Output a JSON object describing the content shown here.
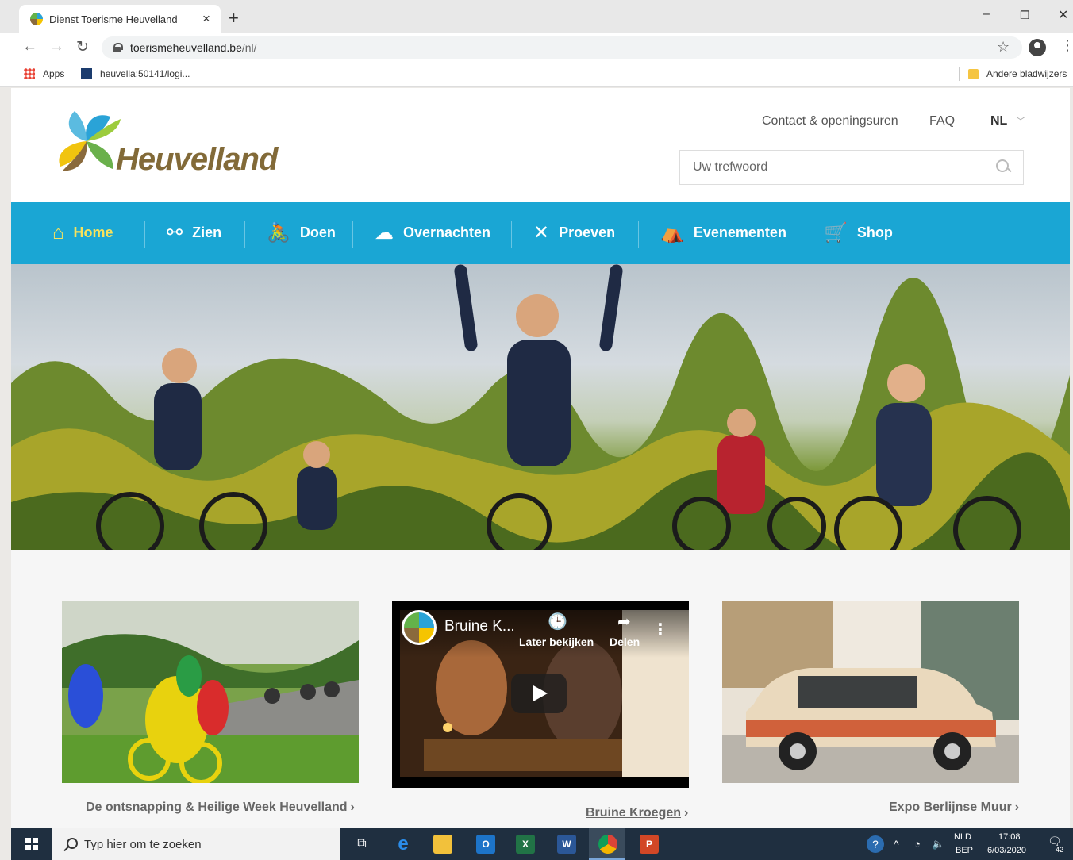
{
  "browser": {
    "tab_title": "Dienst Toerisme Heuvelland",
    "tab_close": "×",
    "new_tab": "+",
    "url_host": "toerismeheuvelland.be",
    "url_path": "/nl/",
    "bookmarks": [
      {
        "label": "Apps",
        "icon": "apps-grid-icon"
      },
      {
        "label": "heuvella:50141/logi..."
      }
    ],
    "other_bookmarks": "Andere bladwijzers",
    "window_controls": {
      "minimize": "–",
      "restore": "❐",
      "close": "✕"
    }
  },
  "site": {
    "logo_text": "Heuvelland",
    "top_links": [
      "Contact & openingsuren",
      "FAQ"
    ],
    "language": "NL",
    "search_placeholder": "Uw trefwoord",
    "nav": [
      {
        "label": "Home",
        "icon": "home-icon",
        "glyph": "⌂",
        "active": true
      },
      {
        "label": "Zien",
        "icon": "binoculars-icon",
        "glyph": "⚯"
      },
      {
        "label": "Doen",
        "icon": "bike-icon",
        "glyph": "🚴"
      },
      {
        "label": "Overnachten",
        "icon": "sleep-icon",
        "glyph": "☁"
      },
      {
        "label": "Proeven",
        "icon": "fork-knife-icon",
        "glyph": "✕"
      },
      {
        "label": "Evenementen",
        "icon": "tent-icon",
        "glyph": "⛺"
      },
      {
        "label": "Shop",
        "icon": "cart-icon",
        "glyph": "🛒"
      }
    ],
    "hero_alt": "cyclists-in-vineyard",
    "teasers": [
      {
        "link": "De ontsnapping & Heilige Week Heuvelland",
        "chevron": "›"
      },
      {
        "link": "Bruine Kroegen",
        "chevron": "›",
        "video": {
          "title": "Bruine K...",
          "later": "Later bekijken",
          "share": "Delen"
        }
      },
      {
        "link": "Expo Berlijnse Muur",
        "chevron": "›"
      }
    ]
  },
  "taskbar": {
    "search_placeholder": "Typ hier om te zoeken",
    "lang": "NLD",
    "layout": "BEP",
    "time": "17:08",
    "date": "6/03/2020",
    "notifications": "42",
    "apps": [
      "task-view",
      "edge",
      "file-explorer",
      "outlook",
      "excel",
      "word",
      "chrome",
      "powerpoint"
    ]
  }
}
